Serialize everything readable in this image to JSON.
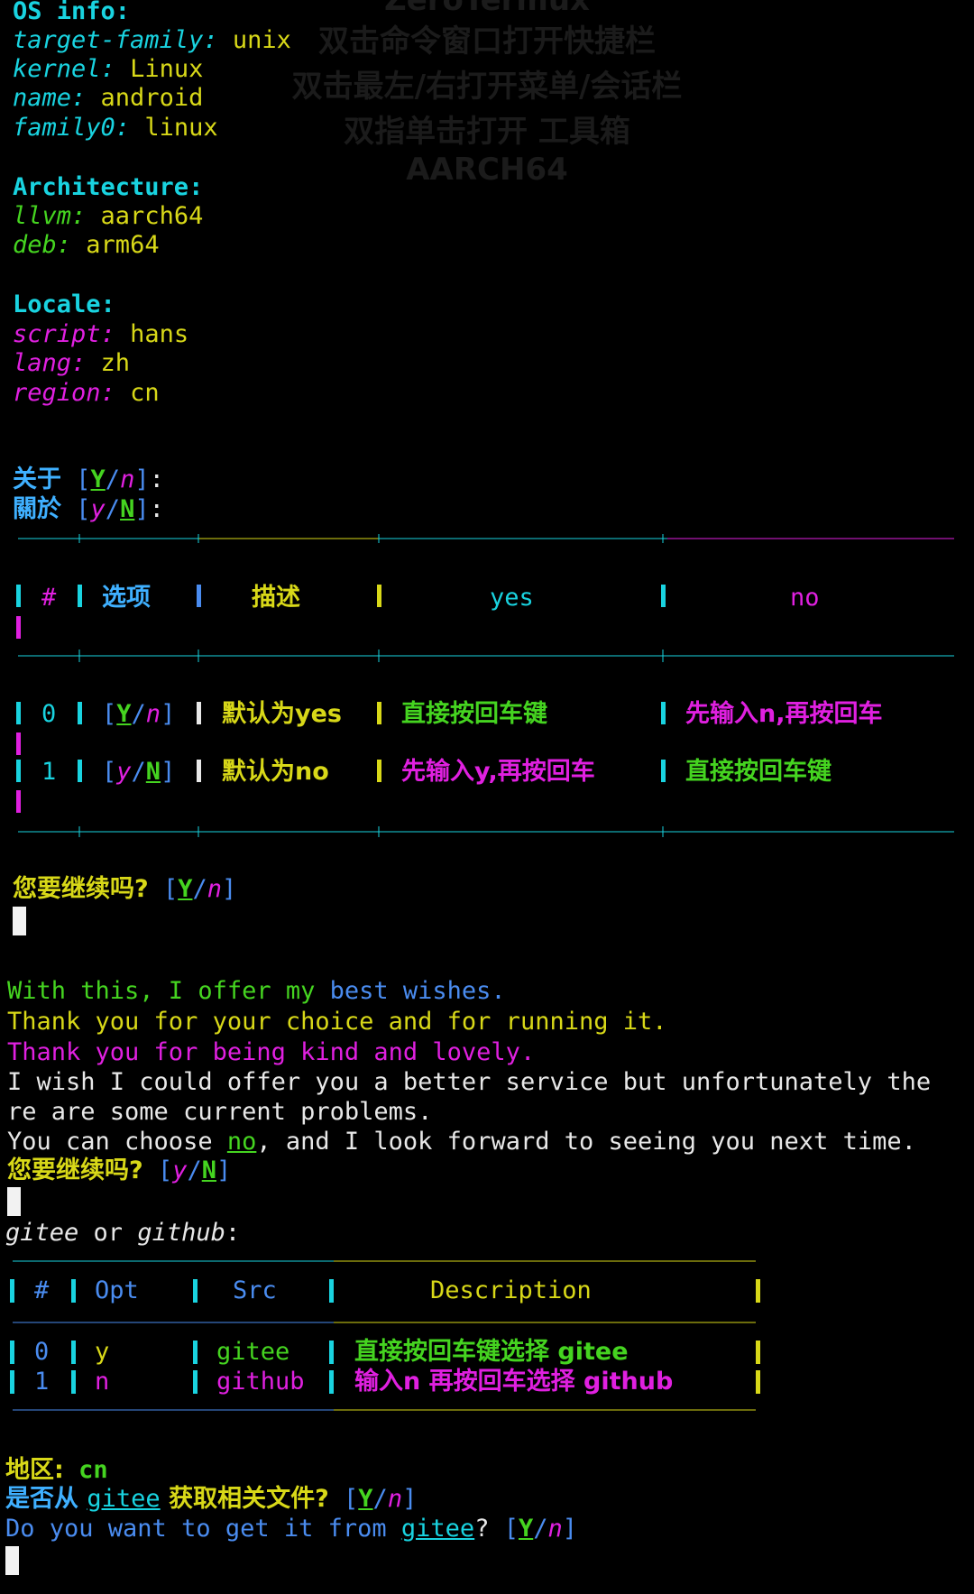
{
  "watermark": {
    "title": "ZeroTermux",
    "line1": "双击命令窗口打开快捷栏",
    "line2": "双击最左/右打开菜单/会话栏",
    "line3": "双指单击打开 工具箱",
    "line4": "AARCH64"
  },
  "os_info": {
    "header": "OS info:",
    "rows": [
      {
        "key": "target-family:",
        "value": "unix"
      },
      {
        "key": "kernel:",
        "value": "Linux"
      },
      {
        "key": "name:",
        "value": "android"
      },
      {
        "key": "family0:",
        "value": "linux"
      }
    ]
  },
  "architecture": {
    "header": "Architecture:",
    "rows": [
      {
        "key": "llvm:",
        "value": "aarch64"
      },
      {
        "key": "deb:",
        "value": "arm64"
      }
    ]
  },
  "locale": {
    "header": "Locale:",
    "rows": [
      {
        "key": "script:",
        "value": "hans"
      },
      {
        "key": "lang:",
        "value": "zh"
      },
      {
        "key": "region:",
        "value": "cn"
      }
    ]
  },
  "about": {
    "simplified": "关于",
    "traditional": "關於",
    "Y": "Y",
    "n": "n",
    "y": "y",
    "N": "N",
    "sep": "/",
    "lb": "[",
    "rb": "]",
    "colon": ":"
  },
  "table1": {
    "headers": [
      "#",
      "选项",
      "描述",
      "yes",
      "no"
    ],
    "rows": [
      {
        "num": "0",
        "opt_a": "Y",
        "opt_b": "n",
        "desc": "默认为yes",
        "yes": "直接按回车键",
        "no": "先输入n,再按回车"
      },
      {
        "num": "1",
        "opt_a": "y",
        "opt_b": "N",
        "desc": "默认为no",
        "yes": "先输入y,再按回车",
        "no": "直接按回车键"
      }
    ]
  },
  "prompt1": {
    "text": "您要继续吗?",
    "Y": "Y",
    "n": "n"
  },
  "message": {
    "line1a": "With this, I offer my ",
    "line1b": "best wishes.",
    "line2": "Thank you for your choice and for running it.",
    "line3": "Thank you for being kind and lovely.",
    "line4": "I wish I could offer you a better service but unfortunately the",
    "line5": "re are some current problems.",
    "line6a": "You can choose ",
    "line6b": "no",
    "line6c": ", and I look forward to seeing you next time."
  },
  "prompt2": {
    "text": "您要继续吗?",
    "y": "y",
    "N": "N"
  },
  "source_question": {
    "gitee": "gitee",
    "or": " or ",
    "github": "github",
    "colon": ":"
  },
  "table2": {
    "headers": [
      "#",
      "Opt",
      "Src",
      "Description"
    ],
    "rows": [
      {
        "num": "0",
        "opt": "y",
        "src": "gitee",
        "desc": "直接按回车键选择 gitee"
      },
      {
        "num": "1",
        "opt": "n",
        "src": "github",
        "desc": "输入n 再按回车选择 github"
      }
    ]
  },
  "region": {
    "label": "地区:",
    "value": "cn"
  },
  "final_prompt": {
    "zh_a": "是否从 ",
    "zh_link": "gitee",
    "zh_b": " 获取相关文件?",
    "en_a": "Do you want to get it from ",
    "en_link": "gitee",
    "en_b": "?",
    "Y": "Y",
    "n": "n"
  },
  "colors": {
    "cyan": "#19d3e0",
    "green": "#45d420",
    "magenta": "#e020e0",
    "yellow": "#d8d818",
    "blue": "#4a8cf0"
  }
}
